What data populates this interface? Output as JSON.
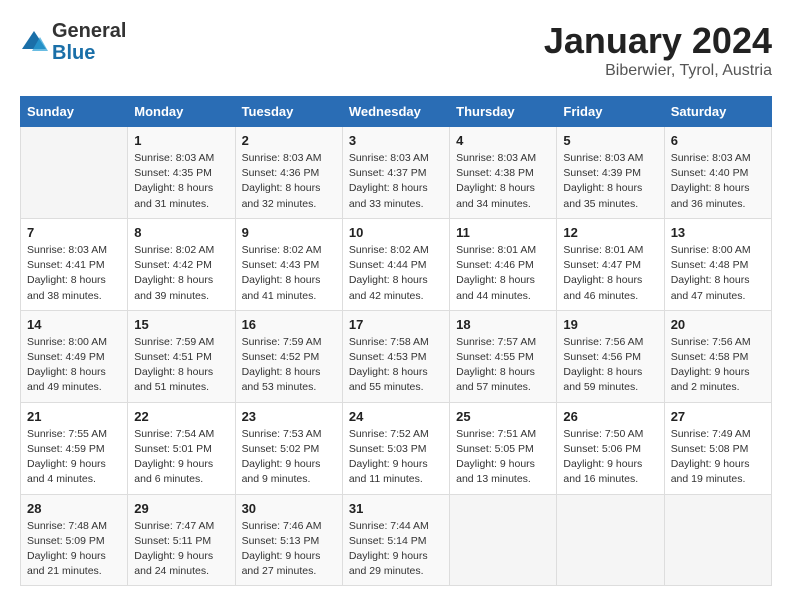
{
  "header": {
    "logo_general": "General",
    "logo_blue": "Blue",
    "month": "January 2024",
    "location": "Biberwier, Tyrol, Austria"
  },
  "weekdays": [
    "Sunday",
    "Monday",
    "Tuesday",
    "Wednesday",
    "Thursday",
    "Friday",
    "Saturday"
  ],
  "weeks": [
    [
      {
        "day": "",
        "sunrise": "",
        "sunset": "",
        "daylight": ""
      },
      {
        "day": "1",
        "sunrise": "Sunrise: 8:03 AM",
        "sunset": "Sunset: 4:35 PM",
        "daylight": "Daylight: 8 hours and 31 minutes."
      },
      {
        "day": "2",
        "sunrise": "Sunrise: 8:03 AM",
        "sunset": "Sunset: 4:36 PM",
        "daylight": "Daylight: 8 hours and 32 minutes."
      },
      {
        "day": "3",
        "sunrise": "Sunrise: 8:03 AM",
        "sunset": "Sunset: 4:37 PM",
        "daylight": "Daylight: 8 hours and 33 minutes."
      },
      {
        "day": "4",
        "sunrise": "Sunrise: 8:03 AM",
        "sunset": "Sunset: 4:38 PM",
        "daylight": "Daylight: 8 hours and 34 minutes."
      },
      {
        "day": "5",
        "sunrise": "Sunrise: 8:03 AM",
        "sunset": "Sunset: 4:39 PM",
        "daylight": "Daylight: 8 hours and 35 minutes."
      },
      {
        "day": "6",
        "sunrise": "Sunrise: 8:03 AM",
        "sunset": "Sunset: 4:40 PM",
        "daylight": "Daylight: 8 hours and 36 minutes."
      }
    ],
    [
      {
        "day": "7",
        "sunrise": "Sunrise: 8:03 AM",
        "sunset": "Sunset: 4:41 PM",
        "daylight": "Daylight: 8 hours and 38 minutes."
      },
      {
        "day": "8",
        "sunrise": "Sunrise: 8:02 AM",
        "sunset": "Sunset: 4:42 PM",
        "daylight": "Daylight: 8 hours and 39 minutes."
      },
      {
        "day": "9",
        "sunrise": "Sunrise: 8:02 AM",
        "sunset": "Sunset: 4:43 PM",
        "daylight": "Daylight: 8 hours and 41 minutes."
      },
      {
        "day": "10",
        "sunrise": "Sunrise: 8:02 AM",
        "sunset": "Sunset: 4:44 PM",
        "daylight": "Daylight: 8 hours and 42 minutes."
      },
      {
        "day": "11",
        "sunrise": "Sunrise: 8:01 AM",
        "sunset": "Sunset: 4:46 PM",
        "daylight": "Daylight: 8 hours and 44 minutes."
      },
      {
        "day": "12",
        "sunrise": "Sunrise: 8:01 AM",
        "sunset": "Sunset: 4:47 PM",
        "daylight": "Daylight: 8 hours and 46 minutes."
      },
      {
        "day": "13",
        "sunrise": "Sunrise: 8:00 AM",
        "sunset": "Sunset: 4:48 PM",
        "daylight": "Daylight: 8 hours and 47 minutes."
      }
    ],
    [
      {
        "day": "14",
        "sunrise": "Sunrise: 8:00 AM",
        "sunset": "Sunset: 4:49 PM",
        "daylight": "Daylight: 8 hours and 49 minutes."
      },
      {
        "day": "15",
        "sunrise": "Sunrise: 7:59 AM",
        "sunset": "Sunset: 4:51 PM",
        "daylight": "Daylight: 8 hours and 51 minutes."
      },
      {
        "day": "16",
        "sunrise": "Sunrise: 7:59 AM",
        "sunset": "Sunset: 4:52 PM",
        "daylight": "Daylight: 8 hours and 53 minutes."
      },
      {
        "day": "17",
        "sunrise": "Sunrise: 7:58 AM",
        "sunset": "Sunset: 4:53 PM",
        "daylight": "Daylight: 8 hours and 55 minutes."
      },
      {
        "day": "18",
        "sunrise": "Sunrise: 7:57 AM",
        "sunset": "Sunset: 4:55 PM",
        "daylight": "Daylight: 8 hours and 57 minutes."
      },
      {
        "day": "19",
        "sunrise": "Sunrise: 7:56 AM",
        "sunset": "Sunset: 4:56 PM",
        "daylight": "Daylight: 8 hours and 59 minutes."
      },
      {
        "day": "20",
        "sunrise": "Sunrise: 7:56 AM",
        "sunset": "Sunset: 4:58 PM",
        "daylight": "Daylight: 9 hours and 2 minutes."
      }
    ],
    [
      {
        "day": "21",
        "sunrise": "Sunrise: 7:55 AM",
        "sunset": "Sunset: 4:59 PM",
        "daylight": "Daylight: 9 hours and 4 minutes."
      },
      {
        "day": "22",
        "sunrise": "Sunrise: 7:54 AM",
        "sunset": "Sunset: 5:01 PM",
        "daylight": "Daylight: 9 hours and 6 minutes."
      },
      {
        "day": "23",
        "sunrise": "Sunrise: 7:53 AM",
        "sunset": "Sunset: 5:02 PM",
        "daylight": "Daylight: 9 hours and 9 minutes."
      },
      {
        "day": "24",
        "sunrise": "Sunrise: 7:52 AM",
        "sunset": "Sunset: 5:03 PM",
        "daylight": "Daylight: 9 hours and 11 minutes."
      },
      {
        "day": "25",
        "sunrise": "Sunrise: 7:51 AM",
        "sunset": "Sunset: 5:05 PM",
        "daylight": "Daylight: 9 hours and 13 minutes."
      },
      {
        "day": "26",
        "sunrise": "Sunrise: 7:50 AM",
        "sunset": "Sunset: 5:06 PM",
        "daylight": "Daylight: 9 hours and 16 minutes."
      },
      {
        "day": "27",
        "sunrise": "Sunrise: 7:49 AM",
        "sunset": "Sunset: 5:08 PM",
        "daylight": "Daylight: 9 hours and 19 minutes."
      }
    ],
    [
      {
        "day": "28",
        "sunrise": "Sunrise: 7:48 AM",
        "sunset": "Sunset: 5:09 PM",
        "daylight": "Daylight: 9 hours and 21 minutes."
      },
      {
        "day": "29",
        "sunrise": "Sunrise: 7:47 AM",
        "sunset": "Sunset: 5:11 PM",
        "daylight": "Daylight: 9 hours and 24 minutes."
      },
      {
        "day": "30",
        "sunrise": "Sunrise: 7:46 AM",
        "sunset": "Sunset: 5:13 PM",
        "daylight": "Daylight: 9 hours and 27 minutes."
      },
      {
        "day": "31",
        "sunrise": "Sunrise: 7:44 AM",
        "sunset": "Sunset: 5:14 PM",
        "daylight": "Daylight: 9 hours and 29 minutes."
      },
      {
        "day": "",
        "sunrise": "",
        "sunset": "",
        "daylight": ""
      },
      {
        "day": "",
        "sunrise": "",
        "sunset": "",
        "daylight": ""
      },
      {
        "day": "",
        "sunrise": "",
        "sunset": "",
        "daylight": ""
      }
    ]
  ]
}
